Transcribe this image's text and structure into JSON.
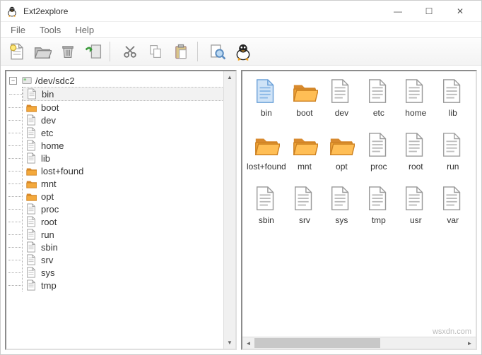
{
  "window": {
    "title": "Ext2explore"
  },
  "menu": {
    "file": "File",
    "tools": "Tools",
    "help": "Help"
  },
  "toolbar": {
    "new": "new",
    "open": "open",
    "delete": "delete",
    "import": "import",
    "cut": "cut",
    "copy": "copy",
    "paste": "paste",
    "search": "search",
    "about": "about"
  },
  "tree": {
    "root": "/dev/sdc2",
    "items": [
      {
        "label": "bin",
        "type": "file",
        "selected": true
      },
      {
        "label": "boot",
        "type": "folder"
      },
      {
        "label": "dev",
        "type": "file"
      },
      {
        "label": "etc",
        "type": "file"
      },
      {
        "label": "home",
        "type": "file"
      },
      {
        "label": "lib",
        "type": "file"
      },
      {
        "label": "lost+found",
        "type": "folder"
      },
      {
        "label": "mnt",
        "type": "folder"
      },
      {
        "label": "opt",
        "type": "folder"
      },
      {
        "label": "proc",
        "type": "file"
      },
      {
        "label": "root",
        "type": "file"
      },
      {
        "label": "run",
        "type": "file"
      },
      {
        "label": "sbin",
        "type": "file"
      },
      {
        "label": "srv",
        "type": "file"
      },
      {
        "label": "sys",
        "type": "file"
      },
      {
        "label": "tmp",
        "type": "file"
      }
    ]
  },
  "grid": {
    "items": [
      {
        "label": "bin",
        "type": "file-sel"
      },
      {
        "label": "boot",
        "type": "folder"
      },
      {
        "label": "dev",
        "type": "file"
      },
      {
        "label": "etc",
        "type": "file"
      },
      {
        "label": "home",
        "type": "file"
      },
      {
        "label": "lib",
        "type": "file"
      },
      {
        "label": "lost+found",
        "type": "folder"
      },
      {
        "label": "mnt",
        "type": "folder"
      },
      {
        "label": "opt",
        "type": "folder"
      },
      {
        "label": "proc",
        "type": "file"
      },
      {
        "label": "root",
        "type": "file"
      },
      {
        "label": "run",
        "type": "file-cut"
      },
      {
        "label": "sbin",
        "type": "file"
      },
      {
        "label": "srv",
        "type": "file"
      },
      {
        "label": "sys",
        "type": "file"
      },
      {
        "label": "tmp",
        "type": "file"
      },
      {
        "label": "usr",
        "type": "file"
      },
      {
        "label": "var",
        "type": "file"
      }
    ]
  },
  "watermark": "wsxdn.com"
}
